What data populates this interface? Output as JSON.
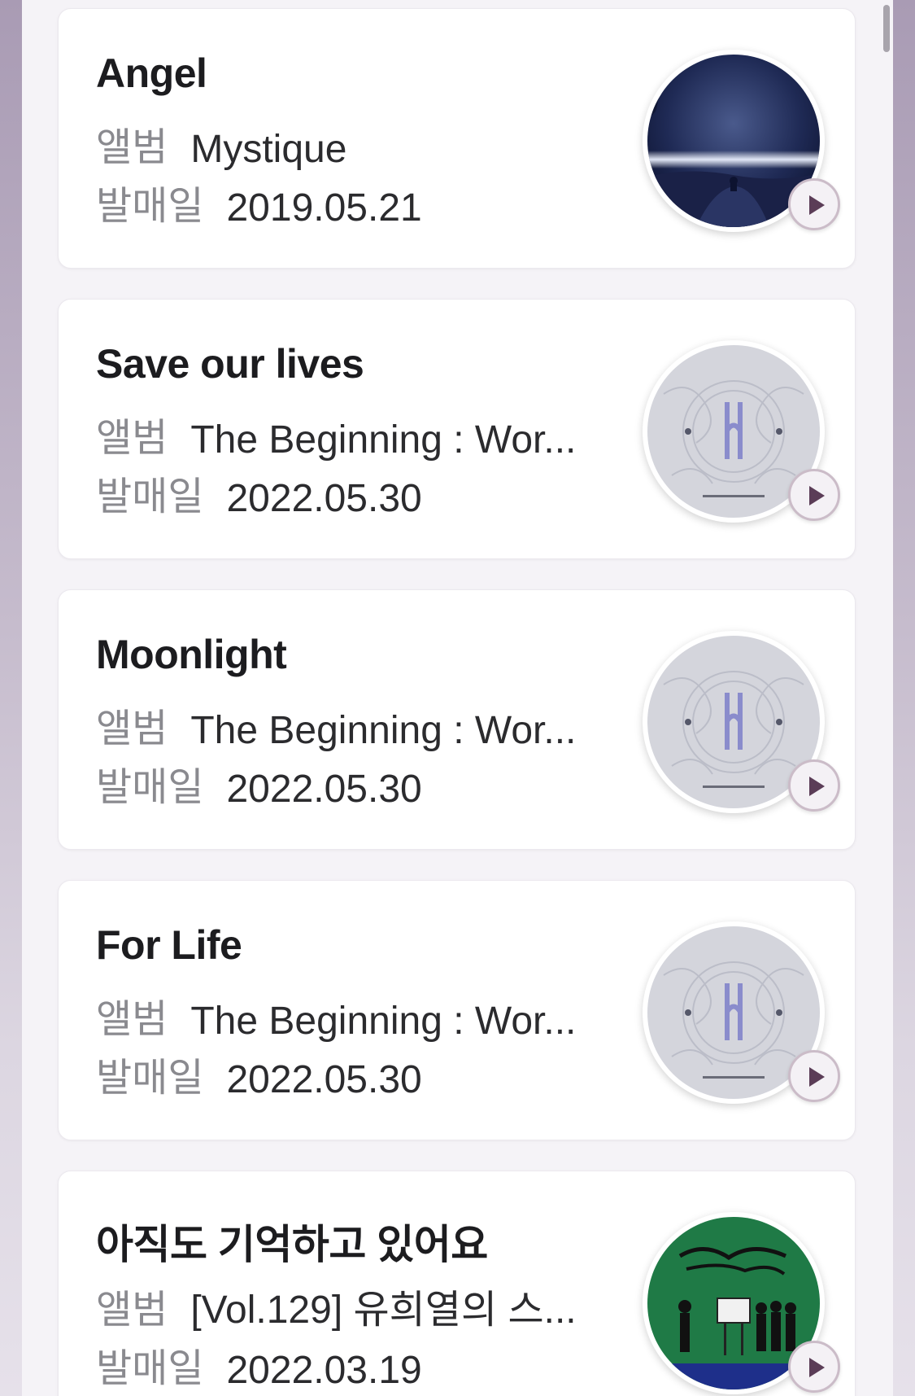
{
  "labels": {
    "album": "앨범",
    "release_date": "발매일"
  },
  "songs": [
    {
      "title": "Angel",
      "album": "Mystique",
      "release_date": "2019.05.21",
      "art_icon": "album-art-mystique"
    },
    {
      "title": "Save our lives",
      "album": "The Beginning : Wor...",
      "release_date": "2022.05.30",
      "art_icon": "album-art-the-beginning"
    },
    {
      "title": "Moonlight",
      "album": "The Beginning : Wor...",
      "release_date": "2022.05.30",
      "art_icon": "album-art-the-beginning"
    },
    {
      "title": "For Life",
      "album": "The Beginning : Wor...",
      "release_date": "2022.05.30",
      "art_icon": "album-art-the-beginning"
    },
    {
      "title": "아직도 기억하고 있어요",
      "album": "[Vol.129] 유희열의 스...",
      "release_date": "2022.03.19",
      "art_icon": "album-art-sketchbook"
    }
  ],
  "colors": {
    "play_icon": "#5b3d57",
    "play_ring": "#cbbcc8",
    "label_gray": "#8a8a8f",
    "title_black": "#1c1c1f"
  }
}
